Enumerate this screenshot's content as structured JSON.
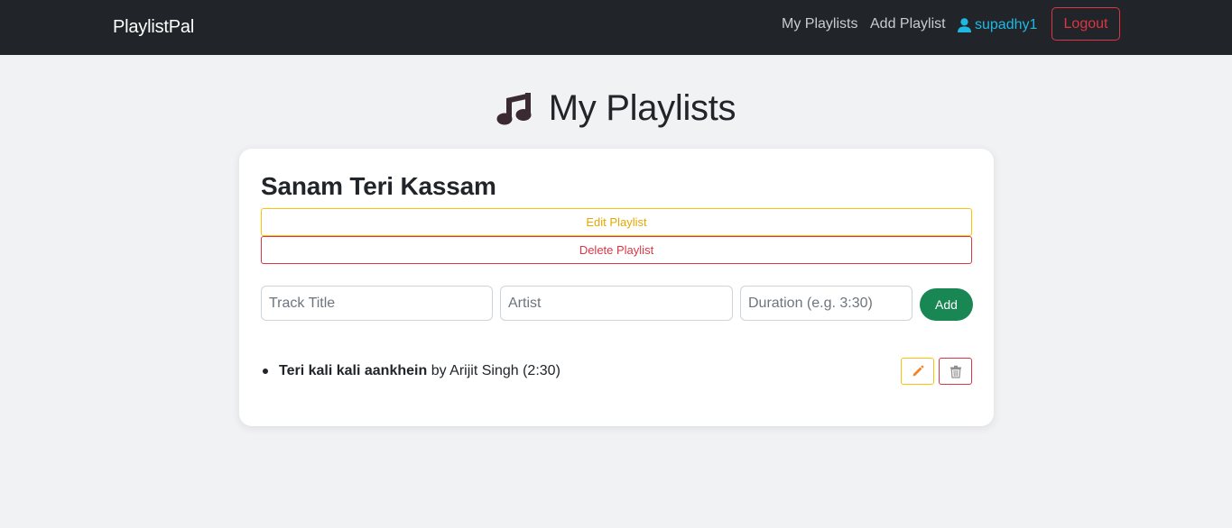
{
  "nav": {
    "brand": "PlaylistPal",
    "links": [
      "My Playlists",
      "Add Playlist"
    ],
    "username": "supadhy1",
    "logout_label": "Logout"
  },
  "page": {
    "title": "My Playlists",
    "title_icon": "music-note-icon"
  },
  "playlist": {
    "name": "Sanam Teri Kassam",
    "edit_label": "Edit Playlist",
    "delete_label": "Delete Playlist",
    "form": {
      "track_placeholder": "Track Title",
      "artist_placeholder": "Artist",
      "duration_placeholder": "Duration (e.g. 3:30)",
      "add_label": "Add"
    },
    "tracks": [
      {
        "title": "Teri kali kali aankhein",
        "by": "by",
        "artist": "Arijit Singh",
        "duration": "(2:30)"
      }
    ]
  },
  "colors": {
    "navbar": "#212529",
    "background": "#f1f2f4",
    "accent_user": "#1fb8e3",
    "danger": "#dc3545",
    "warning": "#ffc107",
    "success": "#198754"
  }
}
